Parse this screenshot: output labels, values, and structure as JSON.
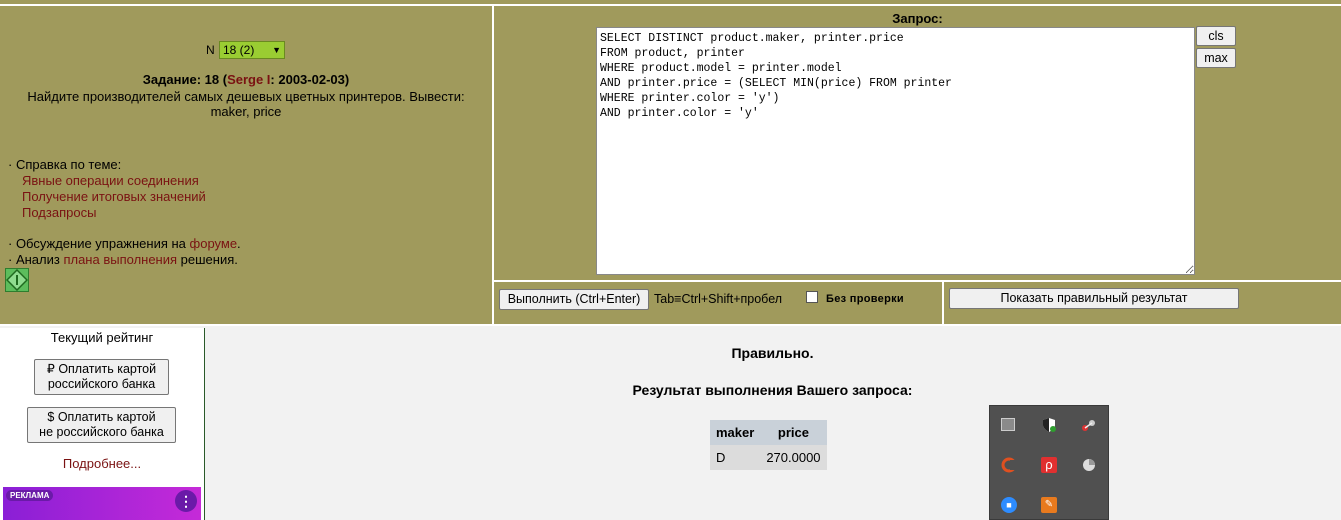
{
  "task": {
    "n_label": "N",
    "select_value": "18 (2)",
    "task_prefix": "Задание: 18 (",
    "author": "Serge I",
    "task_date": ": 2003-02-03)",
    "description_line1": "Найдите производителей самых дешевых цветных принтеров. Вывести:",
    "description_line2": "maker, price"
  },
  "help": {
    "heading": "· Справка по теме:",
    "links": [
      "Явные операции соединения",
      "Получение итоговых значений",
      "Подзапросы"
    ],
    "forum_prefix": "· Обсуждение упражнения на ",
    "forum_link": "форуме",
    "forum_suffix": ".",
    "plan_prefix": "· Анализ ",
    "plan_link": "плана выполнения",
    "plan_suffix": " решения."
  },
  "query": {
    "label": "Запрос:",
    "sql": "SELECT DISTINCT product.maker, printer.price\nFROM product, printer\nWHERE product.model = printer.model\nAND printer.price = (SELECT MIN(price) FROM printer\nWHERE printer.color = 'y')\nAND printer.color = 'y'",
    "cls_label": "cls",
    "max_label": "max"
  },
  "controls": {
    "run_label": "Выполнить (Ctrl+Enter)",
    "tab_hint": "Tab≡Ctrl+Shift+пробел",
    "no_check_label": "Без проверки",
    "show_correct_label": "Показать правильный результат"
  },
  "sidebar": {
    "rating": "Текущий рейтинг",
    "pay_ru_line1": "₽ Оплатить картой",
    "pay_ru_line2": "российского банка",
    "pay_foreign_line1": "$ Оплатить картой",
    "pay_foreign_line2": "не российского банка",
    "more": "Подробнее...",
    "ad_badge": "РЕКЛАМА"
  },
  "result": {
    "status": "Правильно.",
    "heading": "Результат выполнения Вашего запроса:",
    "columns": [
      "maker",
      "price"
    ],
    "rows": [
      [
        "D",
        "270.0000"
      ]
    ]
  },
  "colors": {
    "panel": "#a09a5c",
    "link": "#7a1212",
    "select_bg": "#9acd32"
  }
}
